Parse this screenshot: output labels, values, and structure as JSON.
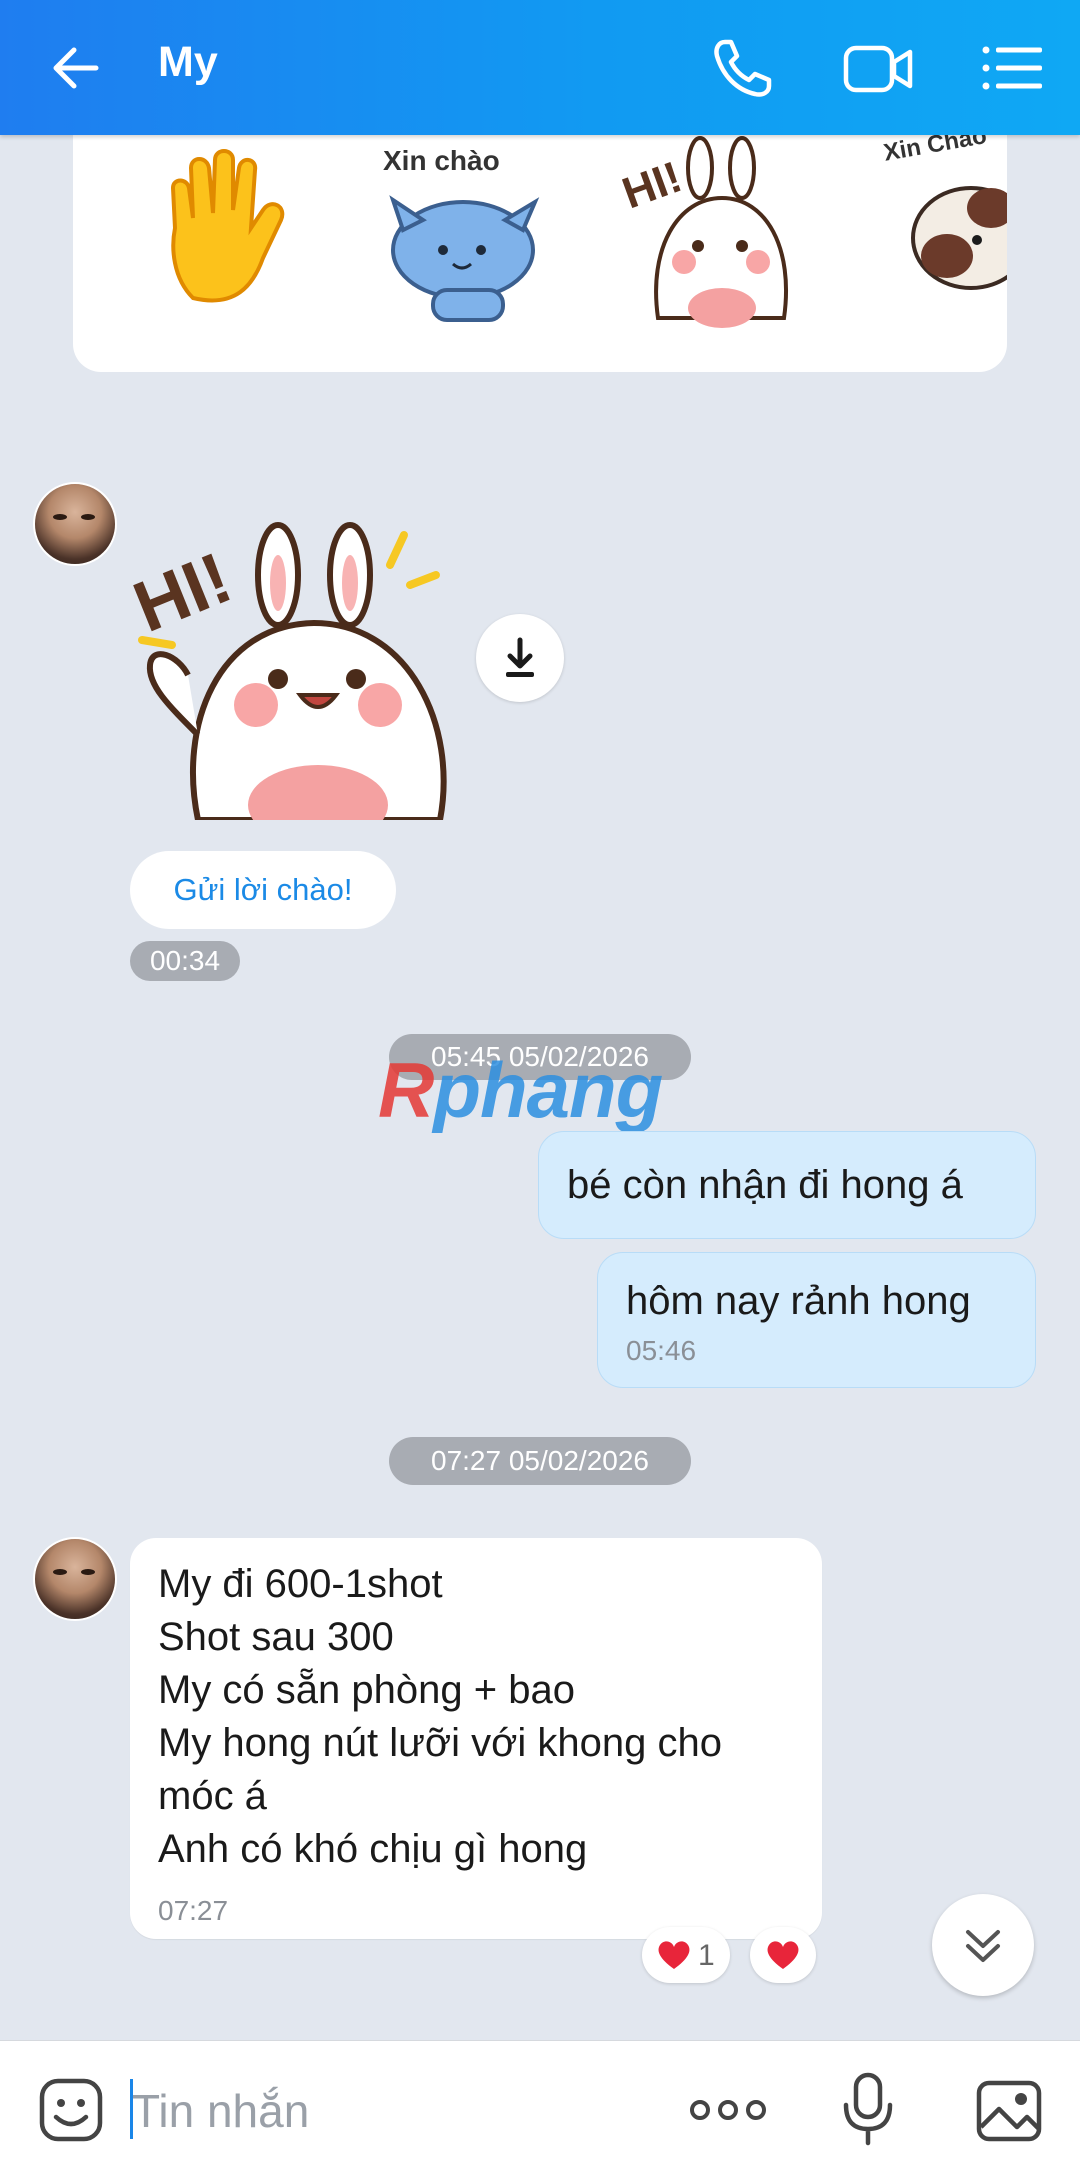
{
  "header": {
    "title": "My",
    "back_icon": "back-arrow-icon",
    "call_icon": "phone-icon",
    "video_icon": "video-call-icon",
    "menu_icon": "list-menu-icon",
    "background": "#1f7df0"
  },
  "sticker_suggestions": {
    "items": [
      {
        "icon": "waving-hand-sticker"
      },
      {
        "icon": "cat-sticker",
        "caption": "Xin chào"
      },
      {
        "icon": "bunny-hi-sticker",
        "caption": "HI!"
      },
      {
        "icon": "dog-sticker",
        "caption": "Xin Chào"
      }
    ]
  },
  "messages": {
    "sticker_message": {
      "sticker_caption": "HI!",
      "greet_button": "Gửi lời chào!",
      "time": "00:34"
    },
    "separator_1": "05:45 05/02/2026",
    "outgoing_1": {
      "text": "bé còn nhận đi hong á"
    },
    "outgoing_2": {
      "text": "hôm nay rảnh hong",
      "time": "05:46"
    },
    "separator_2": "07:27 05/02/2026",
    "incoming_1": {
      "text": "My đi 600-1shot\nShot sau 300\nMy có sẵn phòng + bao\nMy hong nút lưỡi với khong cho móc á\nAnh có khó chịu gì hong",
      "time": "07:27",
      "reaction_count": "1"
    }
  },
  "watermark": {
    "first": "R",
    "rest": "phang"
  },
  "input_bar": {
    "placeholder": "Tin nhắn",
    "emoji_icon": "emoji-icon",
    "more_icon": "more-dots-icon",
    "mic_icon": "microphone-icon",
    "image_icon": "image-icon"
  },
  "colors": {
    "background": "#e2e7ef",
    "outgoing_bubble": "#d5ecfd",
    "accent": "#1b8ae6",
    "heart": "#e8253a"
  }
}
